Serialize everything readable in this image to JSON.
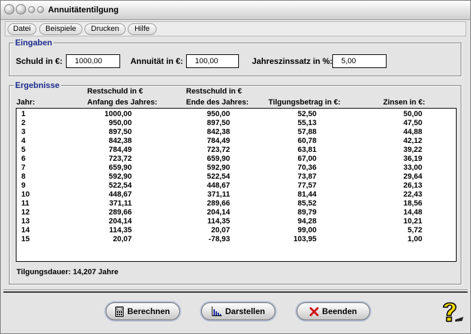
{
  "window": {
    "title": "Annuitätentilgung"
  },
  "menu": [
    {
      "label": "Datei"
    },
    {
      "label": "Beispiele"
    },
    {
      "label": "Drucken"
    },
    {
      "label": "Hilfe"
    }
  ],
  "inputs": {
    "group_title": "Eingaben",
    "schuld_label": "Schuld in €:",
    "schuld_value": "1000,00",
    "annuitaet_label": "Annuität in €:",
    "annuitaet_value": "100,00",
    "zins_label": "Jahreszinssatz in %:",
    "zins_value": "5,00"
  },
  "results": {
    "group_title": "Ergebnisse",
    "headers": {
      "year": "Jahr:",
      "start_line1": "Restschuld in €",
      "start_line2": "Anfang des Jahres:",
      "end_line1": "Restschuld in €",
      "end_line2": "Ende des Jahres:",
      "tilgung": "Tilgungsbetrag in €:",
      "zinsen": "Zinsen in €:"
    },
    "rows": [
      {
        "year": "1",
        "start": "1000,00",
        "end": "950,00",
        "tilgung": "52,50",
        "zinsen": "50,00"
      },
      {
        "year": "2",
        "start": "950,00",
        "end": "897,50",
        "tilgung": "55,13",
        "zinsen": "47,50"
      },
      {
        "year": "3",
        "start": "897,50",
        "end": "842,38",
        "tilgung": "57,88",
        "zinsen": "44,88"
      },
      {
        "year": "4",
        "start": "842,38",
        "end": "784,49",
        "tilgung": "60,78",
        "zinsen": "42,12"
      },
      {
        "year": "5",
        "start": "784,49",
        "end": "723,72",
        "tilgung": "63,81",
        "zinsen": "39,22"
      },
      {
        "year": "6",
        "start": "723,72",
        "end": "659,90",
        "tilgung": "67,00",
        "zinsen": "36,19"
      },
      {
        "year": "7",
        "start": "659,90",
        "end": "592,90",
        "tilgung": "70,36",
        "zinsen": "33,00"
      },
      {
        "year": "8",
        "start": "592,90",
        "end": "522,54",
        "tilgung": "73,87",
        "zinsen": "29,64"
      },
      {
        "year": "9",
        "start": "522,54",
        "end": "448,67",
        "tilgung": "77,57",
        "zinsen": "26,13"
      },
      {
        "year": "10",
        "start": "448,67",
        "end": "371,11",
        "tilgung": "81,44",
        "zinsen": "22,43"
      },
      {
        "year": "11",
        "start": "371,11",
        "end": "289,66",
        "tilgung": "85,52",
        "zinsen": "18,56"
      },
      {
        "year": "12",
        "start": "289,66",
        "end": "204,14",
        "tilgung": "89,79",
        "zinsen": "14,48"
      },
      {
        "year": "13",
        "start": "204,14",
        "end": "114,35",
        "tilgung": "94,28",
        "zinsen": "10,21"
      },
      {
        "year": "14",
        "start": "114,35",
        "end": "20,07",
        "tilgung": "99,00",
        "zinsen": "5,72"
      },
      {
        "year": "15",
        "start": "20,07",
        "end": "-78,93",
        "tilgung": "103,95",
        "zinsen": "1,00"
      }
    ],
    "duration": "Tilgungsdauer: 14,207 Jahre"
  },
  "buttons": {
    "berechnen": "Berechnen",
    "darstellen": "Darstellen",
    "beenden": "Beenden"
  },
  "icons": {
    "calculator": "calculator-icon",
    "chart": "bar-chart-icon",
    "close": "red-x-icon",
    "help": "help-question-icon"
  },
  "colors": {
    "group_title": "#1c2c8c",
    "close_x": "#d01010",
    "help_yellow": "#f2d800"
  }
}
